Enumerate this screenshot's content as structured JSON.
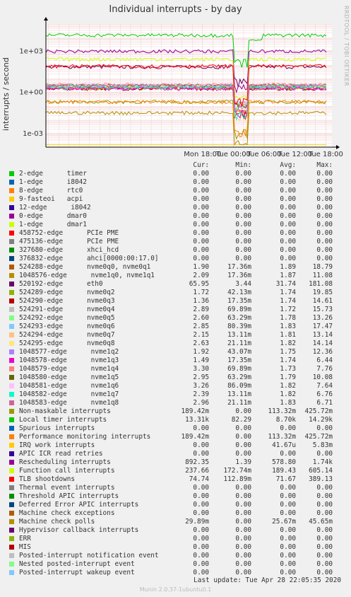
{
  "title": "Individual interrupts - by day",
  "side_credit": "RRDTOOL / TOBI OETIKER",
  "ylabel": "interrupts / second",
  "columns": {
    "cur": "Cur:",
    "min": "Min:",
    "avg": "Avg:",
    "max": "Max:"
  },
  "last_update": "Last update:  Tue Apr 28 22:05:35 2020",
  "version": "Munin 2.0.37-1ubuntu0.1",
  "chart_data": {
    "type": "line",
    "yscale": "log",
    "ylim": [
      0.0001,
      100000
    ],
    "yticks": [
      {
        "value": 0.001,
        "label": "1e-03"
      },
      {
        "value": 1,
        "label": "1e+00"
      },
      {
        "value": 1000,
        "label": "1e+03"
      }
    ],
    "xlim_hours": [
      -12.5,
      43.2
    ],
    "xticks": [
      {
        "hour": 18,
        "label": "Mon 18:00"
      },
      {
        "hour": 24,
        "label": "Tue 00:00"
      },
      {
        "hour": 30,
        "label": "Tue 06:00"
      },
      {
        "hour": 36,
        "label": "Tue 12:00"
      },
      {
        "hour": 42,
        "label": "Tue 18:00"
      }
    ],
    "grid": true,
    "series": [
      {
        "name": "2-edge      timer",
        "color": "#00cc00",
        "cur": "0.00",
        "min": "0.00",
        "avg": "0.00",
        "max": "0.00"
      },
      {
        "name": "1-edge      i8042",
        "color": "#0066b3",
        "cur": "0.00",
        "min": "0.00",
        "avg": "0.00",
        "max": "0.00"
      },
      {
        "name": "8-edge      rtc0",
        "color": "#ff8000",
        "cur": "0.00",
        "min": "0.00",
        "avg": "0.00",
        "max": "0.00"
      },
      {
        "name": "9-fasteoi   acpi",
        "color": "#ffcc00",
        "cur": "0.00",
        "min": "0.00",
        "avg": "0.00",
        "max": "0.00"
      },
      {
        "name": "12-edge      i8042",
        "color": "#330099",
        "cur": "0.00",
        "min": "0.00",
        "avg": "0.00",
        "max": "0.00"
      },
      {
        "name": "0-edge      dmar0",
        "color": "#990099",
        "cur": "0.00",
        "min": "0.00",
        "avg": "0.00",
        "max": "0.00"
      },
      {
        "name": "1-edge      dmar1",
        "color": "#ccff00",
        "cur": "0.00",
        "min": "0.00",
        "avg": "0.00",
        "max": "0.00"
      },
      {
        "name": "458752-edge      PCIe PME",
        "color": "#ff0000",
        "cur": "0.00",
        "min": "0.00",
        "avg": "0.00",
        "max": "0.00"
      },
      {
        "name": "475136-edge      PCIe PME",
        "color": "#808080",
        "cur": "0.00",
        "min": "0.00",
        "avg": "0.00",
        "max": "0.00"
      },
      {
        "name": "327680-edge      xhci_hcd",
        "color": "#008f00",
        "cur": "0.00",
        "min": "0.00",
        "avg": "0.00",
        "max": "0.00"
      },
      {
        "name": "376832-edge      ahci[0000:00:17.0]",
        "color": "#00487d",
        "cur": "0.00",
        "min": "0.00",
        "avg": "0.00",
        "max": "0.00"
      },
      {
        "name": "524288-edge      nvme0q0, nvme0q1",
        "color": "#b35a00",
        "cur": "1.90",
        "min": "17.36m",
        "avg": "1.89",
        "max": "18.79"
      },
      {
        "name": "1048576-edge      nvme1q0, nvme1q1",
        "color": "#b38f00",
        "cur": "2.09",
        "min": "17.36m",
        "avg": "1.87",
        "max": "11.08"
      },
      {
        "name": "520192-edge      eth0",
        "color": "#6b006b",
        "cur": "65.95",
        "min": "3.44",
        "avg": "31.74",
        "max": "181.08"
      },
      {
        "name": "524289-edge      nvme0q2",
        "color": "#8fb300",
        "cur": "1.72",
        "min": "42.13m",
        "avg": "1.74",
        "max": "19.85"
      },
      {
        "name": "524290-edge      nvme0q3",
        "color": "#b30000",
        "cur": "1.36",
        "min": "17.35m",
        "avg": "1.74",
        "max": "14.61"
      },
      {
        "name": "524291-edge      nvme0q4",
        "color": "#bebebe",
        "cur": "2.89",
        "min": "69.89m",
        "avg": "1.72",
        "max": "15.73"
      },
      {
        "name": "524292-edge      nvme0q5",
        "color": "#80ff80",
        "cur": "2.60",
        "min": "63.29m",
        "avg": "1.78",
        "max": "13.26"
      },
      {
        "name": "524293-edge      nvme0q6",
        "color": "#80c9ff",
        "cur": "2.85",
        "min": "80.39m",
        "avg": "1.83",
        "max": "17.47"
      },
      {
        "name": "524294-edge      nvme0q7",
        "color": "#ffc080",
        "cur": "2.15",
        "min": "13.11m",
        "avg": "1.81",
        "max": "13.14"
      },
      {
        "name": "524295-edge      nvme0q8",
        "color": "#ffe680",
        "cur": "2.63",
        "min": "21.11m",
        "avg": "1.82",
        "max": "14.14"
      },
      {
        "name": "1048577-edge      nvme1q2",
        "color": "#aa80ff",
        "cur": "1.92",
        "min": "43.07m",
        "avg": "1.75",
        "max": "12.36"
      },
      {
        "name": "1048578-edge      nvme1q3",
        "color": "#ee00cc",
        "cur": "1.49",
        "min": "17.35m",
        "avg": "1.74",
        "max": "6.44"
      },
      {
        "name": "1048579-edge      nvme1q4",
        "color": "#ff8080",
        "cur": "3.30",
        "min": "69.89m",
        "avg": "1.73",
        "max": "7.76"
      },
      {
        "name": "1048580-edge      nvme1q5",
        "color": "#666600",
        "cur": "2.95",
        "min": "63.29m",
        "avg": "1.79",
        "max": "10.08"
      },
      {
        "name": "1048581-edge      nvme1q6",
        "color": "#ffbfff",
        "cur": "3.26",
        "min": "86.09m",
        "avg": "1.82",
        "max": "7.64"
      },
      {
        "name": "1048582-edge      nvme1q7",
        "color": "#00ffcc",
        "cur": "2.39",
        "min": "13.11m",
        "avg": "1.82",
        "max": "6.76"
      },
      {
        "name": "1048583-edge      nvme1q8",
        "color": "#cc6699",
        "cur": "2.96",
        "min": "21.11m",
        "avg": "1.83",
        "max": "6.71"
      },
      {
        "name": "Non-maskable interrupts",
        "color": "#999900",
        "cur": "189.42m",
        "min": "0.00",
        "avg": "113.32m",
        "max": "425.72m"
      },
      {
        "name": "Local timer interrupts",
        "color": "#00cc00",
        "cur": "13.31k",
        "min": "82.29",
        "avg": "8.70k",
        "max": "14.29k"
      },
      {
        "name": "Spurious interrupts",
        "color": "#0066b3",
        "cur": "0.00",
        "min": "0.00",
        "avg": "0.00",
        "max": "0.00"
      },
      {
        "name": "Performance monitoring interrupts",
        "color": "#ff8000",
        "cur": "189.42m",
        "min": "0.00",
        "avg": "113.32m",
        "max": "425.72m"
      },
      {
        "name": "IRQ work interrupts",
        "color": "#ffcc00",
        "cur": "0.00",
        "min": "0.00",
        "avg": "41.67u",
        "max": "5.83m"
      },
      {
        "name": "APIC ICR read retries",
        "color": "#330099",
        "cur": "0.00",
        "min": "0.00",
        "avg": "0.00",
        "max": "0.00"
      },
      {
        "name": "Rescheduling interrupts",
        "color": "#990099",
        "cur": "892.35",
        "min": "1.39",
        "avg": "578.80",
        "max": "1.74k"
      },
      {
        "name": "Function call interrupts",
        "color": "#ccff00",
        "cur": "237.66",
        "min": "172.74m",
        "avg": "189.43",
        "max": "605.14"
      },
      {
        "name": "TLB shootdowns",
        "color": "#ff0000",
        "cur": "74.74",
        "min": "112.89m",
        "avg": "71.67",
        "max": "389.13"
      },
      {
        "name": "Thermal event interrupts",
        "color": "#808080",
        "cur": "0.00",
        "min": "0.00",
        "avg": "0.00",
        "max": "0.00"
      },
      {
        "name": "Threshold APIC interrupts",
        "color": "#008f00",
        "cur": "0.00",
        "min": "0.00",
        "avg": "0.00",
        "max": "0.00"
      },
      {
        "name": "Deferred Error APIC interrupts",
        "color": "#00487d",
        "cur": "0.00",
        "min": "0.00",
        "avg": "0.00",
        "max": "0.00"
      },
      {
        "name": "Machine check exceptions",
        "color": "#b35a00",
        "cur": "0.00",
        "min": "0.00",
        "avg": "0.00",
        "max": "0.00"
      },
      {
        "name": "Machine check polls",
        "color": "#b38f00",
        "cur": "29.89m",
        "min": "0.00",
        "avg": "25.67m",
        "max": "45.65m"
      },
      {
        "name": "Hypervisor callback interrupts",
        "color": "#6b006b",
        "cur": "0.00",
        "min": "0.00",
        "avg": "0.00",
        "max": "0.00"
      },
      {
        "name": "ERR",
        "color": "#8fb300",
        "cur": "0.00",
        "min": "0.00",
        "avg": "0.00",
        "max": "0.00"
      },
      {
        "name": "MIS",
        "color": "#b30000",
        "cur": "0.00",
        "min": "0.00",
        "avg": "0.00",
        "max": "0.00"
      },
      {
        "name": "Posted-interrupt notification event",
        "color": "#bebebe",
        "cur": "0.00",
        "min": "0.00",
        "avg": "0.00",
        "max": "0.00"
      },
      {
        "name": "Nested posted-interrupt event",
        "color": "#80ff80",
        "cur": "0.00",
        "min": "0.00",
        "avg": "0.00",
        "max": "0.00"
      },
      {
        "name": "Posted-interrupt wakeup event",
        "color": "#80c9ff",
        "cur": "0.00",
        "min": "0.00",
        "avg": "0.00",
        "max": "0.00"
      }
    ]
  }
}
